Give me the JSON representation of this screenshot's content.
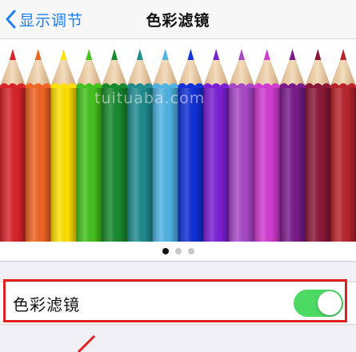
{
  "navbar": {
    "back_label": "显示调节",
    "title": "色彩滤镜"
  },
  "preview": {
    "watermark": "tuituaba.com",
    "pencil_colors": [
      "#d9242b",
      "#f06424",
      "#ffe100",
      "#44c21f",
      "#188a2e",
      "#1f8c8f",
      "#4fb3e3",
      "#1030d8",
      "#7b1fd6",
      "#a848c8",
      "#d23bd2",
      "#7a1a8a",
      "#8a1838",
      "#b8242c"
    ]
  },
  "pager": {
    "pages": 3,
    "active_index": 0
  },
  "setting": {
    "label": "色彩滤镜",
    "enabled": true
  },
  "colors": {
    "accent": "#1e7ff5",
    "toggle_on": "#4cd964",
    "highlight": "#e02020"
  }
}
